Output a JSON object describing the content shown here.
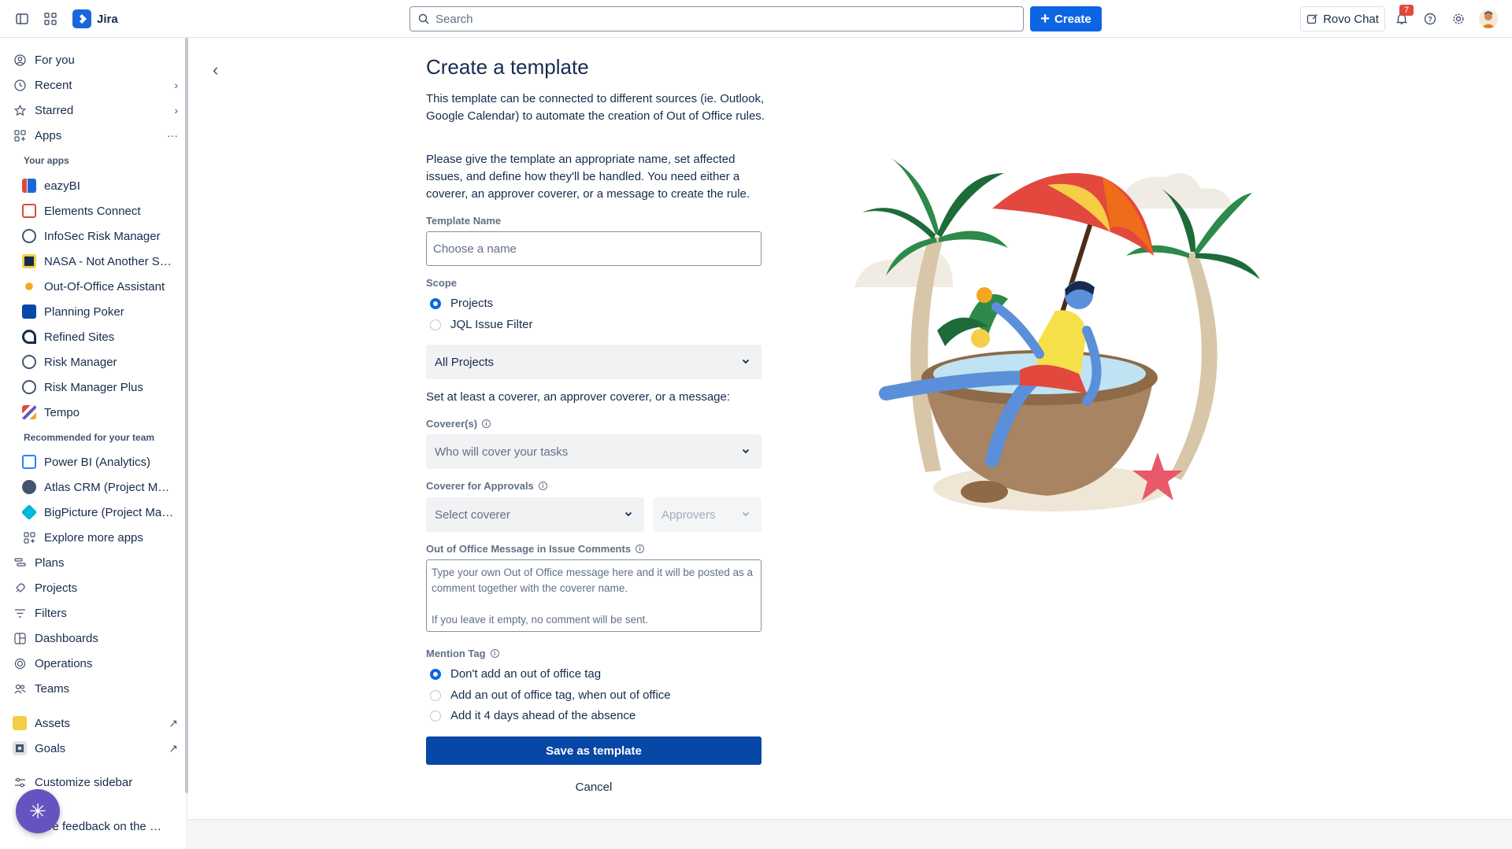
{
  "topbar": {
    "app_name": "Jira",
    "search_placeholder": "Search",
    "create_label": "Create",
    "rovo_label": "Rovo Chat",
    "notifications_count": "7"
  },
  "sidebar": {
    "for_you": "For you",
    "recent": "Recent",
    "starred": "Starred",
    "apps": "Apps",
    "your_apps_heading": "Your apps",
    "your_apps": [
      {
        "label": "eazyBI",
        "color": "#e2483d"
      },
      {
        "label": "Elements Connect",
        "color": "#e2483d"
      },
      {
        "label": "InfoSec Risk Manager",
        "color": "#44546f"
      },
      {
        "label": "NASA - Not Another Survey App",
        "color": "#172b4d"
      },
      {
        "label": "Out-Of-Office Assistant",
        "color": "#f5a623"
      },
      {
        "label": "Planning Poker",
        "color": "#1868db"
      },
      {
        "label": "Refined Sites",
        "color": "#172b4d"
      },
      {
        "label": "Risk Manager",
        "color": "#44546f"
      },
      {
        "label": "Risk Manager Plus",
        "color": "#44546f"
      },
      {
        "label": "Tempo",
        "color": "#e2483d"
      }
    ],
    "recommended_heading": "Recommended for your team",
    "recommended_apps": [
      {
        "label": "Power BI (Analytics)",
        "color": "#2684ff"
      },
      {
        "label": "Atlas CRM (Project Management)",
        "color": "#44546f"
      },
      {
        "label": "BigPicture (Project Management)",
        "color": "#00b8d9"
      }
    ],
    "explore_more": "Explore more apps",
    "plans": "Plans",
    "projects": "Projects",
    "filters": "Filters",
    "dashboards": "Dashboards",
    "operations": "Operations",
    "teams": "Teams",
    "assets": "Assets",
    "goals": "Goals",
    "customize": "Customize sidebar",
    "feedback": "Give feedback on the new navigation"
  },
  "form": {
    "title": "Create a template",
    "intro_1": "This template can be connected to different sources (ie. Outlook, Google Calendar) to automate the creation of Out of Office rules.",
    "intro_2": "Please give the template an appropriate name, set affected issues, and define how they'll be handled. You need either a coverer, an approver coverer, or a message to create the rule.",
    "template_name_label": "Template Name",
    "template_name_placeholder": "Choose a name",
    "scope_label": "Scope",
    "scope_options": [
      "Projects",
      "JQL Issue Filter"
    ],
    "scope_selected": "Projects",
    "projects_select": "All Projects",
    "coverer_instruction": "Set at least a coverer, an approver coverer, or a message:",
    "coverers_label": "Coverer(s)",
    "coverers_placeholder": "Who will cover your tasks",
    "approvals_label": "Coverer for Approvals",
    "select_coverer": "Select coverer",
    "approvers": "Approvers",
    "message_label": "Out of Office Message in Issue Comments",
    "message_placeholder_1": "Type your own Out of Office message here and it will be posted as a comment together with the coverer name.",
    "message_placeholder_2": "If you leave it empty, no comment will be sent.",
    "mention_label": "Mention Tag",
    "mention_options": [
      "Don't add an out of office tag",
      "Add an out of office tag, when out of office",
      "Add it 4 days ahead of the absence"
    ],
    "mention_selected": "Don't add an out of office tag",
    "save_label": "Save as template",
    "cancel_label": "Cancel"
  },
  "colors": {
    "primary": "#0c66e4",
    "save_button": "#0747a6",
    "text": "#172b4d",
    "subtle": "#626f86"
  }
}
